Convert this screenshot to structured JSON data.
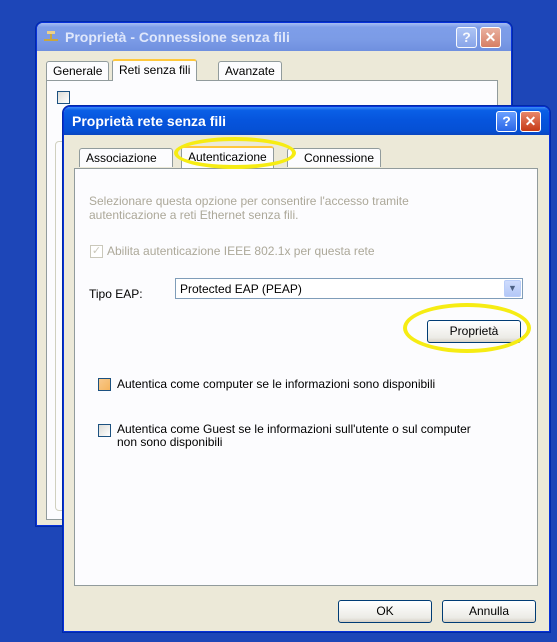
{
  "back_window": {
    "title": "Proprietà - Connessione senza fili",
    "help_glyph": "?",
    "close_glyph": "✕",
    "tabs": [
      {
        "label": "Generale"
      },
      {
        "label": "Reti senza fili"
      },
      {
        "label": "Avanzate"
      }
    ],
    "active_tab": 1
  },
  "dialog": {
    "title": "Proprietà rete senza fili",
    "help_glyph": "?",
    "close_glyph": "✕",
    "tabs": [
      {
        "label": "Associazione"
      },
      {
        "label": "Autenticazione"
      },
      {
        "label": "Connessione"
      }
    ],
    "active_tab": 1,
    "description": "Selezionare questa opzione per consentire l'accesso tramite autenticazione a reti Ethernet senza fili.",
    "ieee_checkbox": {
      "label": "Abilita autenticazione IEEE 802.1x per questa rete",
      "checked": true,
      "disabled": true
    },
    "eap_label": "Tipo EAP:",
    "eap_value": "Protected EAP (PEAP)",
    "properties_button": "Proprietà",
    "computer_auth": {
      "label": "Autentica come computer se le informazioni sono disponibili",
      "checked": false
    },
    "guest_auth": {
      "label": "Autentica come Guest se le informazioni sull'utente o sul computer non sono disponibili",
      "checked": false
    },
    "ok_button": "OK",
    "cancel_button": "Annulla"
  },
  "annotations": {
    "highlight_color": "#f6ec13"
  },
  "colors": {
    "desktop": "#1d46b8",
    "titlebar": "#0654dc",
    "window_face": "#ece9d8"
  }
}
